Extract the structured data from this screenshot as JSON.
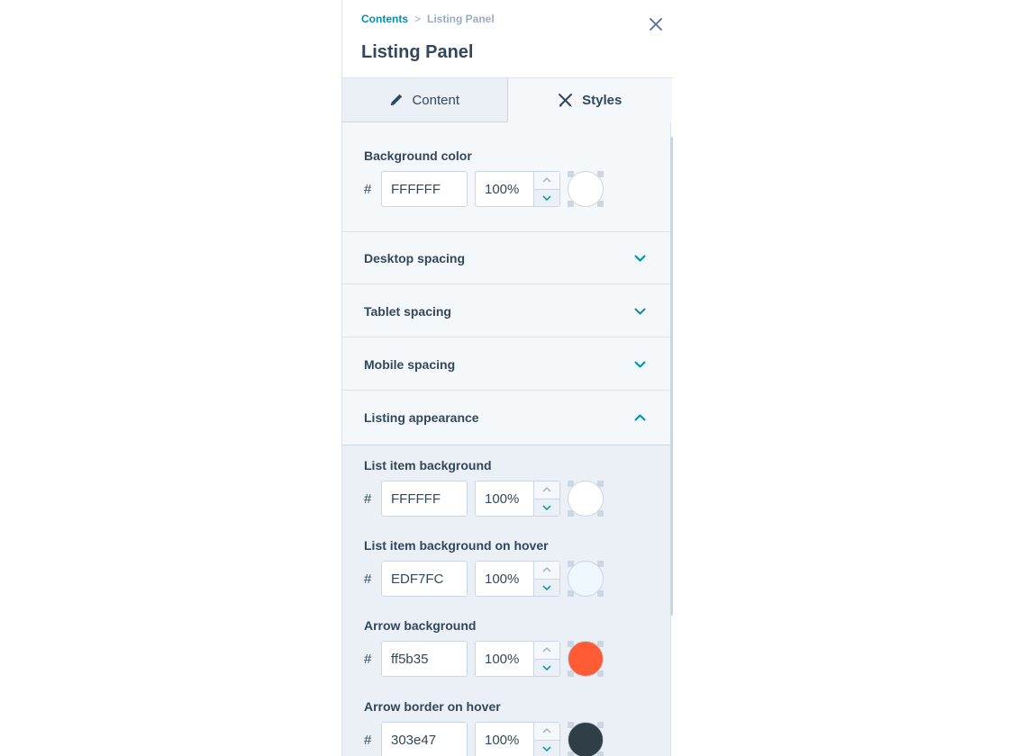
{
  "header": {
    "breadcrumb": {
      "parent": "Contents",
      "separator": ">",
      "current": "Listing Panel"
    },
    "title": "Listing Panel"
  },
  "tabs": [
    {
      "label": "Content",
      "icon": "pencil-icon",
      "active": false
    },
    {
      "label": "Styles",
      "icon": "paint-brush-icon",
      "active": true
    }
  ],
  "background": {
    "label": "Background color",
    "hash": "#",
    "hex": "FFFFFF",
    "opacity": "100%",
    "swatch_color": "#FFFFFF"
  },
  "accordions": [
    {
      "label": "Desktop spacing",
      "expanded": false
    },
    {
      "label": "Tablet spacing",
      "expanded": false
    },
    {
      "label": "Mobile spacing",
      "expanded": false
    },
    {
      "label": "Listing appearance",
      "expanded": true
    }
  ],
  "listing_colors": [
    {
      "label": "List item background",
      "hash": "#",
      "hex": "FFFFFF",
      "opacity": "100%",
      "swatch_color": "#FFFFFF"
    },
    {
      "label": "List item background on hover",
      "hash": "#",
      "hex": "EDF7FC",
      "opacity": "100%",
      "swatch_color": "#EDF7FC"
    },
    {
      "label": "Arrow background",
      "hash": "#",
      "hex": "ff5b35",
      "opacity": "100%",
      "swatch_color": "#ff5b35"
    },
    {
      "label": "Arrow border on hover",
      "hash": "#",
      "hex": "303e47",
      "opacity": "100%",
      "swatch_color": "#303e47"
    }
  ],
  "colors": {
    "accent": "#0091ae",
    "text": "#33475b",
    "muted": "#99acc2",
    "border": "#cbd6e2"
  }
}
